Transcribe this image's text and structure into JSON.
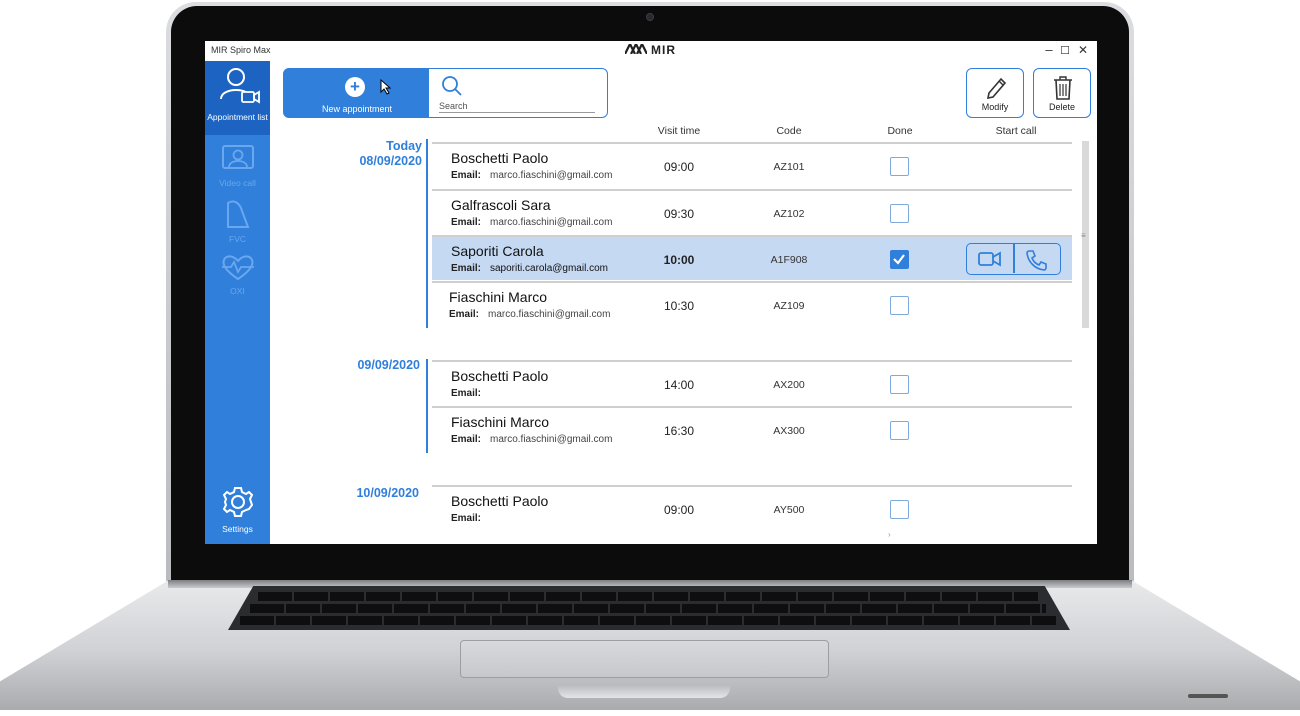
{
  "window": {
    "title": "MIR Spiro Max",
    "brand": "MIR",
    "controls": {
      "minimize": "–",
      "maximize": "☐",
      "close": "✕"
    }
  },
  "sidebar": {
    "items": [
      {
        "label": "Appointment list",
        "icon": "user-video-icon",
        "active": true
      },
      {
        "label": "Video call",
        "icon": "video-call-icon",
        "active": false
      },
      {
        "label": "FVC",
        "icon": "fvc-icon",
        "active": false
      },
      {
        "label": "OXI",
        "icon": "oxi-icon",
        "active": false
      }
    ],
    "settings": {
      "label": "Settings",
      "icon": "gear-icon"
    }
  },
  "toolbar": {
    "new_appointment": "New appointment",
    "search_placeholder": "Search",
    "modify": "Modify",
    "delete": "Delete"
  },
  "columns": {
    "visit_time": "Visit time",
    "code": "Code",
    "done": "Done",
    "start_call": "Start call"
  },
  "groups": [
    {
      "today_label": "Today",
      "date": "08/09/2020",
      "appointments": [
        {
          "name": "Boschetti Paolo",
          "email_label": "Email:",
          "email": "marco.fiaschini@gmail.com",
          "time": "09:00",
          "code": "AZ101",
          "done": false
        },
        {
          "name": "Galfrascoli Sara",
          "email_label": "Email:",
          "email": "marco.fiaschini@gmail.com",
          "time": "09:30",
          "code": "AZ102",
          "done": false
        },
        {
          "name": "Saporiti Carola",
          "email_label": "Email:",
          "email": "saporiti.carola@gmail.com",
          "time": "10:00",
          "code": "A1F908",
          "done": true,
          "selected": true
        },
        {
          "name": "Fiaschini Marco",
          "email_label": "Email:",
          "email": "marco.fiaschini@gmail.com",
          "time": "10:30",
          "code": "AZ109",
          "done": false
        }
      ]
    },
    {
      "date": "09/09/2020",
      "appointments": [
        {
          "name": "Boschetti Paolo",
          "email_label": "Email:",
          "email": "",
          "time": "14:00",
          "code": "AX200",
          "done": false
        },
        {
          "name": "Fiaschini Marco",
          "email_label": "Email:",
          "email": "marco.fiaschini@gmail.com",
          "time": "16:30",
          "code": "AX300",
          "done": false
        }
      ]
    },
    {
      "date": "10/09/2020",
      "appointments": [
        {
          "name": "Boschetti Paolo",
          "email_label": "Email:",
          "email": "",
          "time": "09:00",
          "code": "AY500",
          "done": false
        }
      ]
    }
  ],
  "colors": {
    "accent": "#2f7fdb",
    "sidebar_active": "#1d64c2",
    "selected_row": "#c6d9f3"
  }
}
